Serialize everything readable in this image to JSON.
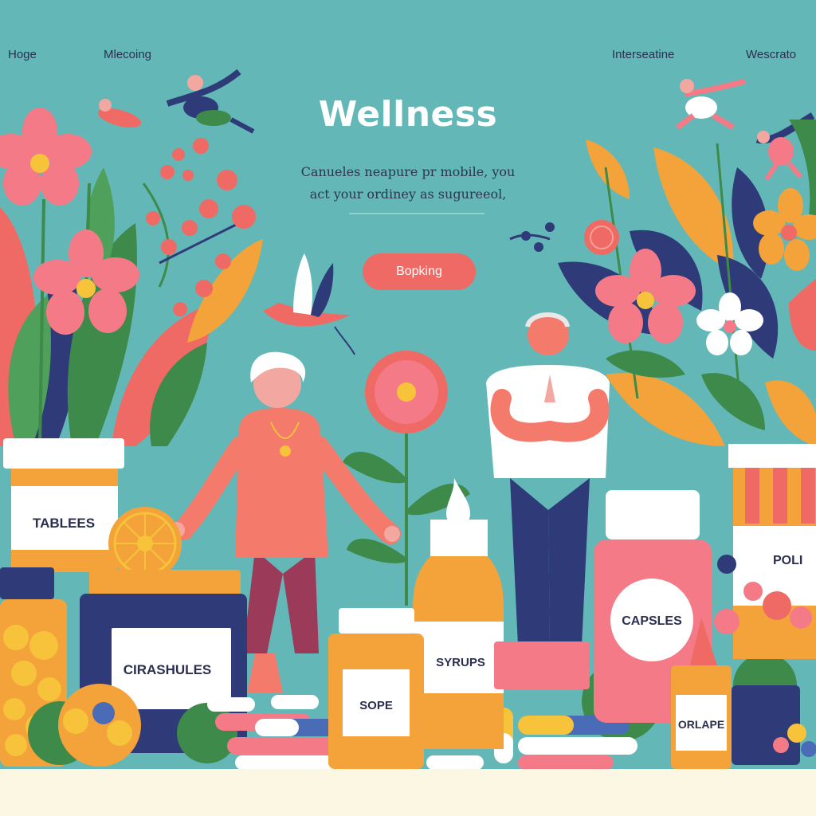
{
  "nav": {
    "items": [
      {
        "label": "Hoge"
      },
      {
        "label": "Mlecoing"
      },
      {
        "label": "Interseatine"
      },
      {
        "label": "Wescrato"
      }
    ]
  },
  "hero": {
    "title": "Wellness",
    "tagline_line1": "Canueles neapure pr mobile, you",
    "tagline_line2": "act your ordiney as sugureeol,",
    "cta_label": "Bopking"
  },
  "products": {
    "tablets_label": "TABLEES",
    "capsules_jar_label": "CIRASHULES",
    "syrups_label": "SYRUPS",
    "capsules_label": "CAPSLES",
    "soap_label": "SOPE",
    "orange_label": "ORLAPE",
    "pills_label": "POLI"
  },
  "colors": {
    "background": "#63b8b7",
    "accent": "#ef6a64",
    "title": "#ffffff",
    "text": "#2f3350",
    "floor": "#fbf7e3"
  }
}
